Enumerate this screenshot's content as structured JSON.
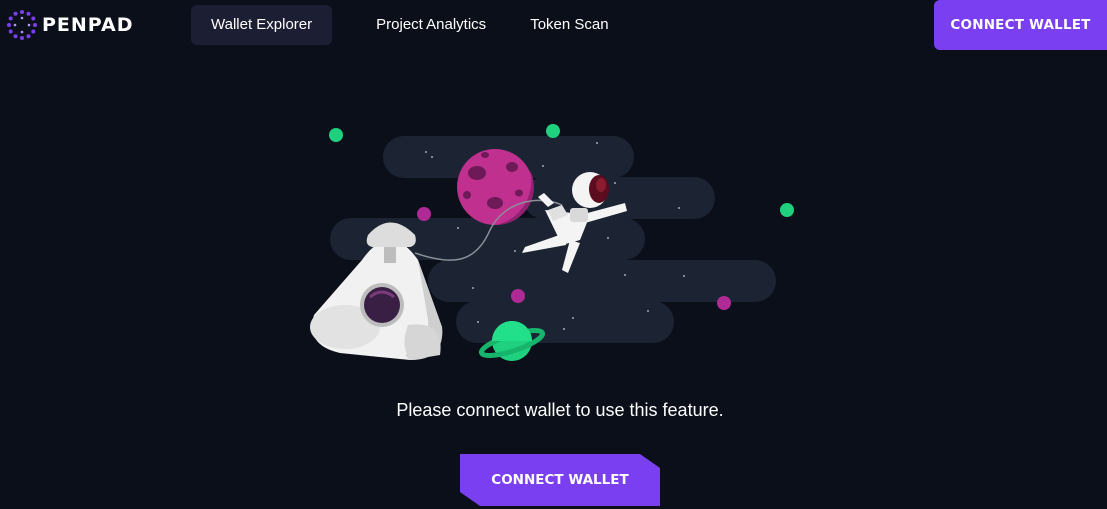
{
  "brand": {
    "name": "PENPAD",
    "accent": "#7b3ff2"
  },
  "nav": {
    "items": [
      {
        "label": "Wallet Explorer",
        "active": true
      },
      {
        "label": "Project Analytics",
        "active": false
      },
      {
        "label": "Token Scan",
        "active": false
      }
    ]
  },
  "header": {
    "connect_label": "CONNECT WALLET"
  },
  "main": {
    "message": "Please connect wallet to use this feature.",
    "connect_label": "CONNECT WALLET"
  },
  "illustration": {
    "name": "space-astronaut-illustration",
    "colors": {
      "background": "#0b0f1a",
      "cloud": "#1c2433",
      "planet": "#c0318f",
      "green": "#1fd17f"
    }
  }
}
